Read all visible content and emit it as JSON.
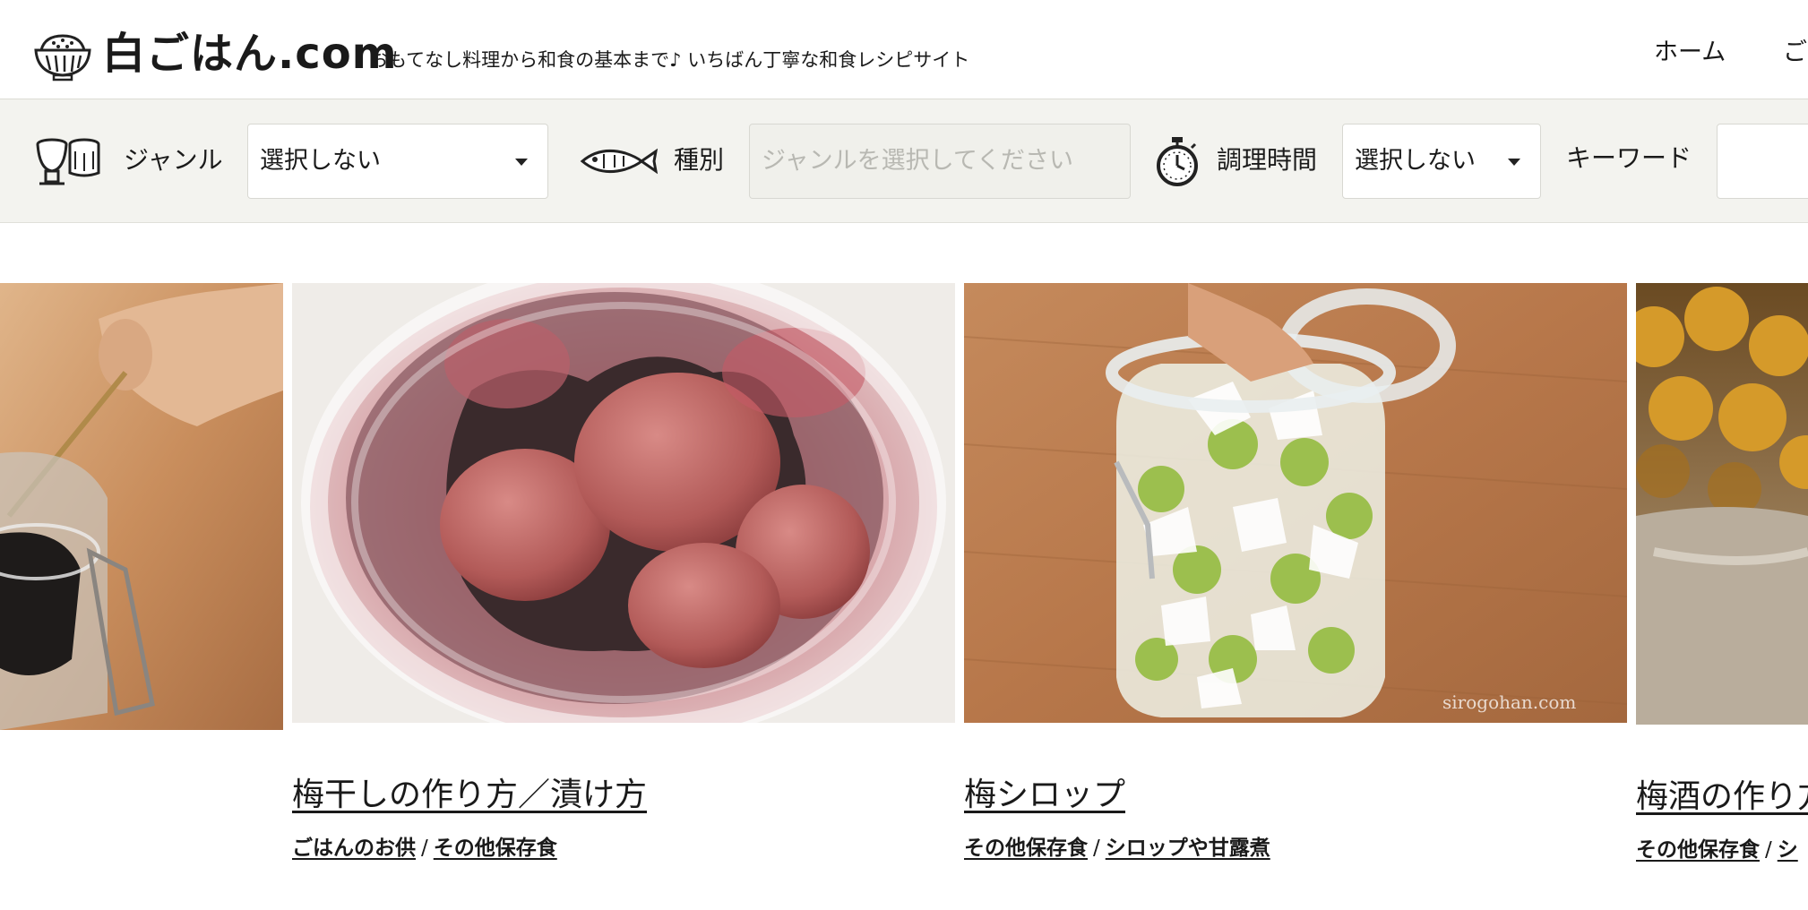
{
  "header": {
    "logo_text": "白ごはん.com",
    "tagline": "おもてなし料理から和食の基本まで♪ いちばん丁寧な和食レシピサイト",
    "nav": {
      "home": "ホーム",
      "next": "ご"
    }
  },
  "search": {
    "genre": {
      "label": "ジャンル",
      "value": "選択しない"
    },
    "type": {
      "label": "種別",
      "placeholder": "ジャンルを選択してください"
    },
    "time": {
      "label": "調理時間",
      "value": "選択しない"
    },
    "keyword": {
      "label": "キーワード",
      "value": ""
    }
  },
  "slides": [
    {
      "title": "",
      "categories": []
    },
    {
      "title": "梅干しの作り方／漬け方",
      "categories": [
        "ごはんのお供",
        "その他保存食"
      ]
    },
    {
      "title": "梅シロップ",
      "categories": [
        "その他保存食",
        "シロップや甘露煮"
      ],
      "watermark": "sirogohan.com"
    },
    {
      "title": "梅酒の作り方",
      "categories": [
        "その他保存食",
        "シ"
      ]
    }
  ],
  "separator": "/"
}
